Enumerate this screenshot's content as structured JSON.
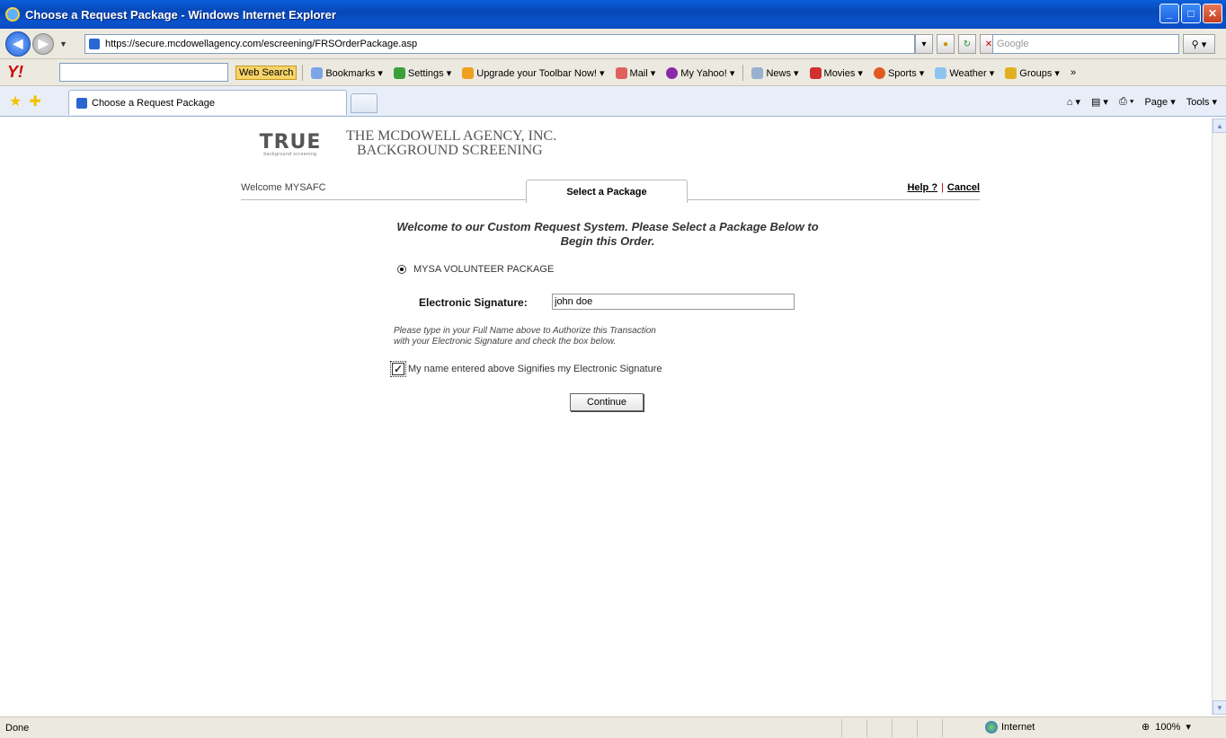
{
  "window": {
    "title": "Choose a Request Package - Windows Internet Explorer",
    "min": "_",
    "max": "□",
    "close": "✕"
  },
  "address_bar": {
    "url": "https://secure.mcdowellagency.com/escreening/FRSOrderPackage.asp",
    "search_placeholder": "Google",
    "back": "◀",
    "forward": "▶"
  },
  "yahoo_toolbar": {
    "logo": "Y!",
    "web_search": "Web Search",
    "items": [
      "Bookmarks ▾",
      "Settings ▾",
      "Upgrade your Toolbar Now! ▾",
      "Mail ▾",
      "My Yahoo! ▾",
      "News ▾",
      "Movies ▾",
      "Sports ▾",
      "Weather ▾",
      "Groups ▾",
      "»"
    ]
  },
  "tabs": {
    "active_tab": "Choose a Request Package",
    "tools": [
      "Page ▾",
      "Tools ▾"
    ],
    "home": "⌂ ▾",
    "feeds": "▤ ▾",
    "print": "⎙ ▾"
  },
  "page": {
    "logo_text": "TRUE",
    "logo_sub": "background screening",
    "company_line1": "THE MCDOWELL AGENCY, INC.",
    "company_line2": "BACKGROUND SCREENING",
    "welcome": "Welcome MYSAFC",
    "active_tab": "Select a Package",
    "help": "Help ?",
    "pipe": "|",
    "cancel": "Cancel",
    "intro": "Welcome to our Custom Request System. Please Select a Package Below to Begin this Order.",
    "package_option": "MYSA VOLUNTEER PACKAGE",
    "signature_label": "Electronic Signature:",
    "signature_value": "john doe",
    "note_line1": "Please type in your Full Name above to Authorize this Transaction",
    "note_line2": "with your Electronic Signature and check the box below.",
    "checkbox_label": "My name entered above Signifies my Electronic Signature",
    "checkbox_mark": "✓",
    "continue_button": "Continue"
  },
  "status_bar": {
    "status": "Done",
    "zone": "Internet",
    "zoom": "100%"
  }
}
